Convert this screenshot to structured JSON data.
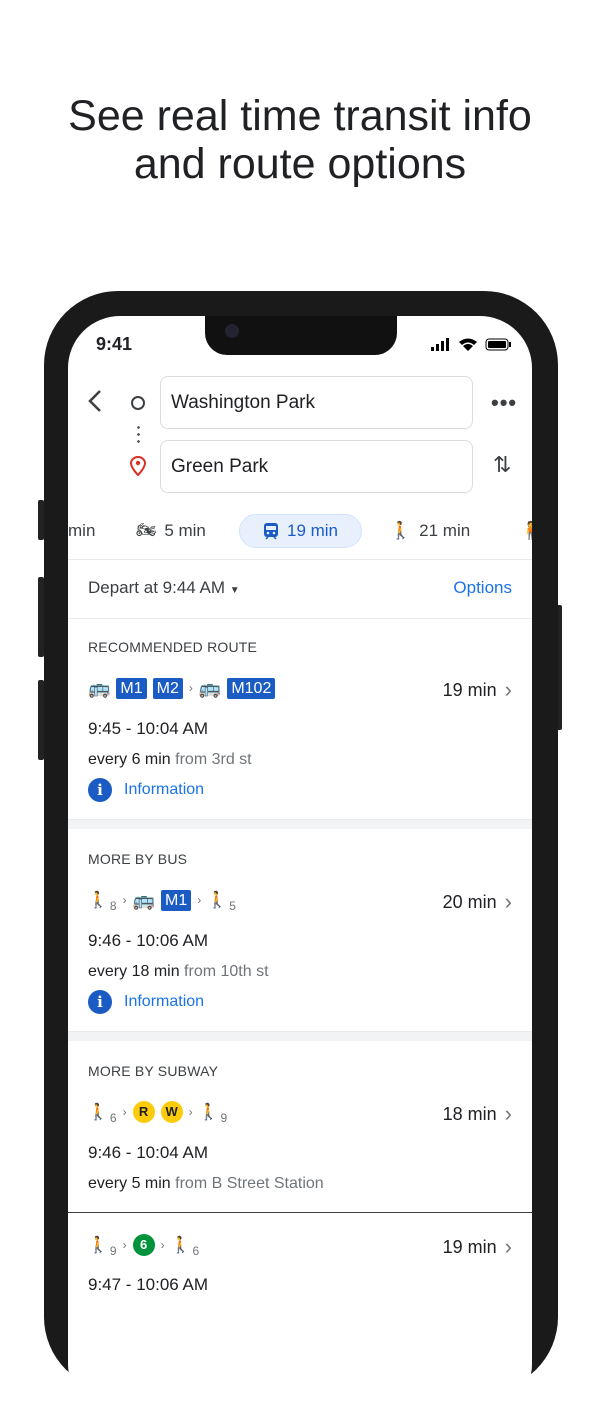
{
  "headline": {
    "line1": "See real time transit info",
    "line2": "and route options"
  },
  "status": {
    "time": "9:41"
  },
  "search": {
    "origin": "Washington Park",
    "destination": "Green Park"
  },
  "modes": [
    {
      "icon": "car-icon",
      "label": "min"
    },
    {
      "icon": "motorcycle-icon",
      "label": "5 min"
    },
    {
      "icon": "transit-icon",
      "label": "19 min",
      "selected": true
    },
    {
      "icon": "walk-icon",
      "label": "21 min"
    },
    {
      "icon": "ride-icon",
      "label": ""
    }
  ],
  "depart": {
    "label": "Depart at 9:44 AM",
    "options": "Options"
  },
  "colors": {
    "accent": "#1a73e8",
    "badge": "#1a5bc4",
    "selected_tab": "#e8f0fe",
    "line_rw": "#fccc0a",
    "line_6": "#00933c"
  },
  "sections": [
    {
      "header": "RECOMMENDED ROUTE",
      "routes": [
        {
          "lines": [
            "M1",
            "M2",
            "M102"
          ],
          "duration": "19 min",
          "times": "9:45 - 10:04 AM",
          "every": "every 6 min",
          "from": "from 3rd st",
          "info": "Information"
        }
      ]
    },
    {
      "header": "MORE BY BUS",
      "routes": [
        {
          "walk1": "8",
          "lines": [
            "M1"
          ],
          "walk2": "5",
          "duration": "20 min",
          "times": "9:46 - 10:06 AM",
          "every": "every 18 min",
          "from": "from 10th st",
          "info": "Information"
        }
      ]
    },
    {
      "header": "MORE BY SUBWAY",
      "routes": [
        {
          "walk1": "6",
          "lines": [
            "R",
            "W"
          ],
          "walk2": "9",
          "duration": "18 min",
          "times": "9:46 - 10:04 AM",
          "every": "every 5 min",
          "from": "from B Street Station"
        },
        {
          "walk1": "9",
          "lines": [
            "6"
          ],
          "walk2": "6",
          "duration": "19 min",
          "times": "9:47 - 10:06 AM"
        }
      ]
    }
  ]
}
